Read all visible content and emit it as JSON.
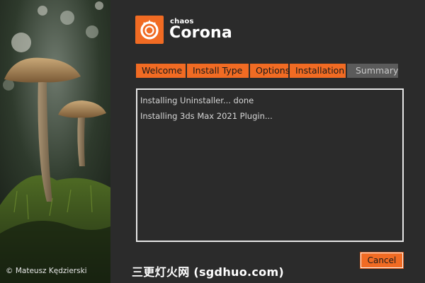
{
  "photo": {
    "credit": "© Mateusz Kędzierski"
  },
  "brand": {
    "company": "chaos",
    "product": "Corona",
    "accent_color": "#f16b23",
    "logo_icon": "corona-sun-logo"
  },
  "steps": [
    {
      "label": "Welcome",
      "state": "done"
    },
    {
      "label": "Install Type",
      "state": "done"
    },
    {
      "label": "Options",
      "state": "done"
    },
    {
      "label": "Installation",
      "state": "active"
    },
    {
      "label": "Summary",
      "state": "pending"
    }
  ],
  "log": {
    "lines": [
      "Installing Uninstaller... done",
      "Installing 3ds Max 2021 Plugin..."
    ]
  },
  "buttons": {
    "cancel": "Cancel"
  },
  "watermark": "三更灯火网 (sgdhuo.com)"
}
